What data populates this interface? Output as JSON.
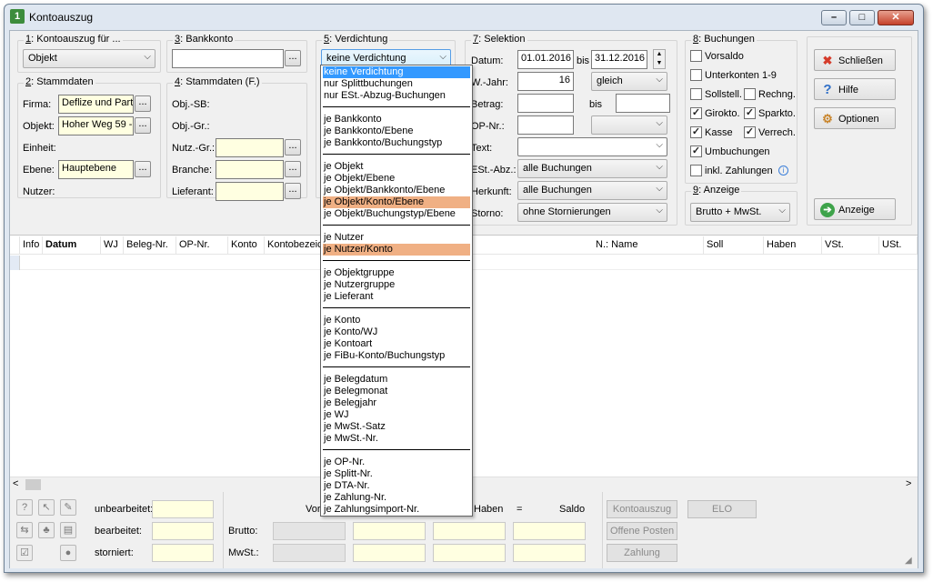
{
  "window": {
    "title": "Kontoauszug",
    "min": "–",
    "max": "□",
    "close": "✕"
  },
  "kontoauszug": {
    "title_num": "1",
    "title": ": Kontoauszug für ...",
    "value": "Objekt"
  },
  "bankkonto": {
    "title_num": "3",
    "title": ": Bankkonto",
    "button": "..."
  },
  "verdichtung": {
    "title_num": "5",
    "title": ": Verdichtung",
    "value": "keine Verdichtung"
  },
  "selektion": {
    "title_num": "7",
    "title": ": Selektion",
    "datum_label": "Datum:",
    "datum_from": "01.01.2016",
    "bis": "bis",
    "datum_to": "31.12.2016",
    "wjahr_label": "W.-Jahr:",
    "wjahr_value": "16",
    "wjahr_op": "gleich",
    "betrag_label": "Betrag:",
    "betrag_bis": "bis",
    "opnr_label": "OP-Nr.:",
    "text_label": "Text:",
    "est_label": "ESt.-Abz.:",
    "est_value": "alle Buchungen",
    "herkunft_label": "Herkunft:",
    "herkunft_value": "alle Buchungen",
    "storno_label": "Storno:",
    "storno_value": "ohne Stornierungen"
  },
  "stammdaten": {
    "title_num": "2",
    "title": ": Stammdaten",
    "firma_label": "Firma:",
    "firma_value": "Deflize und Part",
    "objekt_label": "Objekt:",
    "objekt_value": "Hoher Weg 59 -",
    "einheit_label": "Einheit:",
    "ebene_label": "Ebene:",
    "ebene_value": "Hauptebene",
    "nutzer_label": "Nutzer:",
    "btn": "..."
  },
  "stammdaten_f": {
    "title_num": "4",
    "title": ": Stammdaten (F.)",
    "objsb_label": "Obj.-SB:",
    "objgr_label": "Obj.-Gr.:",
    "nutzgr_label": "Nutz.-Gr.:",
    "branche_label": "Branche:",
    "lieferant_label": "Lieferant:",
    "btn": "..."
  },
  "buchungen": {
    "title_num": "8",
    "title": ": Buchungen",
    "items": [
      {
        "label": "Vorsaldo",
        "checked": ""
      },
      {
        "label": "Unterkonten 1-9",
        "checked": ""
      },
      {
        "label": "Sollstell.",
        "checked": ""
      },
      {
        "label": "Rechng.",
        "checked": ""
      },
      {
        "label": "Girokto.",
        "checked": "✓"
      },
      {
        "label": "Sparkto.",
        "checked": "✓"
      },
      {
        "label": "Kasse",
        "checked": "✓"
      },
      {
        "label": "Verrech.",
        "checked": "✓"
      },
      {
        "label": "Umbuchungen",
        "checked": "✓"
      },
      {
        "label": "inkl. Zahlungen",
        "checked": ""
      }
    ],
    "info": "i"
  },
  "anzeige_grp": {
    "title_num": "9",
    "title": ": Anzeige",
    "value": "Brutto + MwSt."
  },
  "actions": {
    "schliessen": "Schließen",
    "hilfe": "Hilfe",
    "optionen": "Optionen",
    "anzeige": "Anzeige"
  },
  "table": {
    "columns": [
      "Info",
      "Datum",
      "WJ",
      "Beleg-Nr.",
      "OP-Nr.",
      "Konto",
      "Kontobezeic",
      "N.: Name",
      "Soll",
      "Haben",
      "VSt.",
      "USt."
    ]
  },
  "dropdown": {
    "options": [
      "keine Verdichtung",
      "nur Splittbuchungen",
      "nur ESt.-Abzug-Buchungen",
      "je Bankkonto",
      "je Bankkonto/Ebene",
      "je Bankkonto/Buchungstyp",
      "je Objekt",
      "je Objekt/Ebene",
      "je Objekt/Bankkonto/Ebene",
      "je Objekt/Konto/Ebene",
      "je Objekt/Buchungstyp/Ebene",
      "je Nutzer",
      "je Nutzer/Konto",
      "je Objektgruppe",
      "je Nutzergruppe",
      "je Lieferant",
      "je Konto",
      "je Konto/WJ",
      "je Kontoart",
      "je FiBu-Konto/Buchungstyp",
      "je Belegdatum",
      "je Belegmonat",
      "je Belegjahr",
      "je WJ",
      "je MwSt.-Satz",
      "je MwSt.-Nr.",
      "je OP-Nr.",
      "je Splitt-Nr.",
      "je DTA-Nr.",
      "je Zahlung-Nr.",
      "je Zahlungsimport-Nr."
    ]
  },
  "status": {
    "unbearbeitet": "unbearbeitet:",
    "bearbeitet": "bearbeitet:",
    "storniert": "storniert:",
    "vor": "Vor",
    "haben": "Haben",
    "eq": "=",
    "saldo": "Saldo",
    "brutto": "Brutto:",
    "mwst": "MwSt.:"
  },
  "bottom_buttons": {
    "kontoauszug": "Kontoauszug",
    "elo": "ELO",
    "offene_posten": "Offene Posten",
    "zahlung": "Zahlung"
  },
  "scroll": {
    "left": "<",
    "right": ">"
  }
}
